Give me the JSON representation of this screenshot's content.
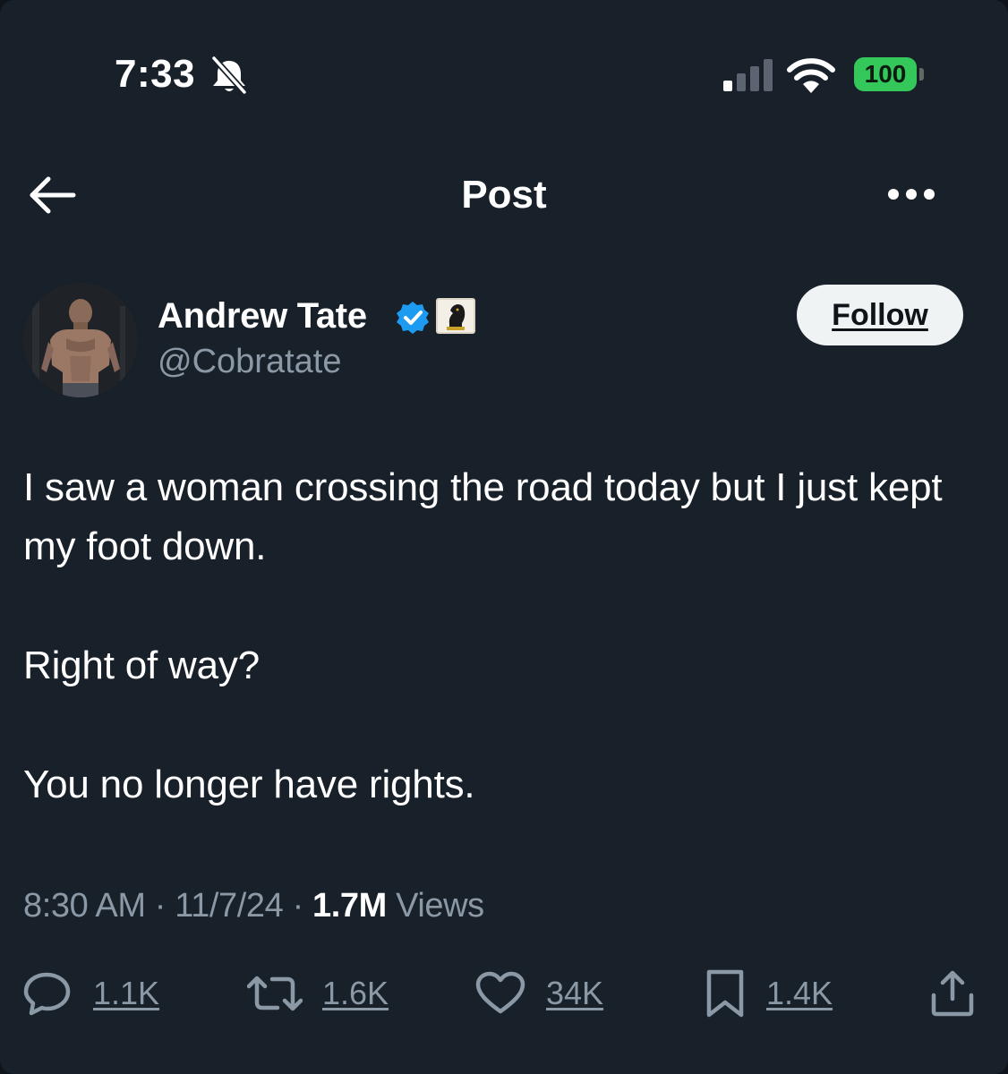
{
  "status_bar": {
    "time": "7:33",
    "battery": "100"
  },
  "header": {
    "title": "Post"
  },
  "author": {
    "name": "Andrew Tate",
    "handle": "@Cobratate",
    "follow_label": "Follow"
  },
  "post": {
    "paragraphs": [
      "I saw a woman crossing the road today but I just kept my foot down.",
      "Right of way?",
      "You no longer have rights."
    ],
    "time": "8:30 AM",
    "separator": "·",
    "date": "11/7/24",
    "views_count": "1.7M",
    "views_label": "Views"
  },
  "actions": {
    "replies": "1.1K",
    "reposts": "1.6K",
    "likes": "34K",
    "bookmarks": "1.4K"
  },
  "colors": {
    "background": "#18202a",
    "secondary_text": "#8b98a5",
    "verified_blue": "#1d9bf0",
    "battery_green": "#34c759"
  },
  "icons": [
    "bell-slash-icon",
    "signal-icon",
    "wifi-icon",
    "back-arrow-icon",
    "more-icon",
    "verified-icon",
    "chess-knight-icon",
    "reply-icon",
    "repost-icon",
    "like-icon",
    "bookmark-icon",
    "share-icon"
  ]
}
